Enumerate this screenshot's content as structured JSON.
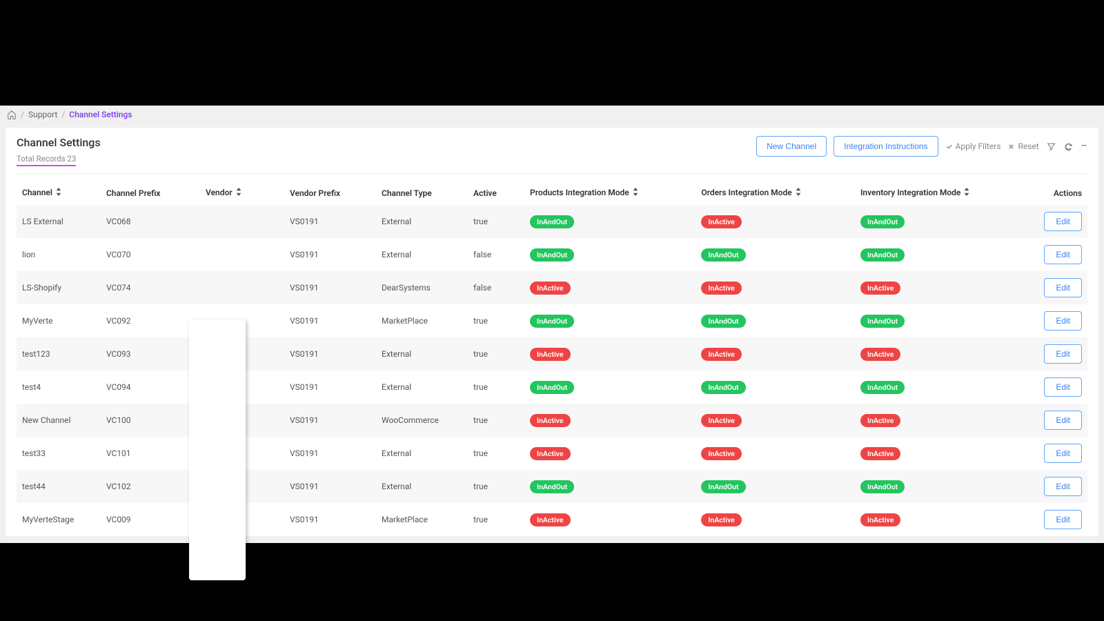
{
  "breadcrumb": {
    "support": "Support",
    "current": "Channel Settings"
  },
  "page": {
    "title": "Channel Settings",
    "subtitle": "Total Records 23"
  },
  "buttons": {
    "new_channel": "New Channel",
    "integration_instructions": "Integration Instructions",
    "apply_filters": "Apply Filters",
    "reset": "Reset",
    "edit": "Edit"
  },
  "columns": {
    "channel": "Channel",
    "channel_prefix": "Channel Prefix",
    "vendor": "Vendor",
    "vendor_prefix": "Vendor Prefix",
    "channel_type": "Channel Type",
    "active": "Active",
    "products_mode": "Products Integration Mode",
    "orders_mode": "Orders Integration Mode",
    "inventory_mode": "Inventory Integration Mode",
    "actions": "Actions"
  },
  "badge_labels": {
    "InAndOut": "InAndOut",
    "InActive": "InActive"
  },
  "rows": [
    {
      "channel": "LS External",
      "prefix": "VC068",
      "vendor": "",
      "vprefix": "VS0191",
      "ctype": "External",
      "active": "true",
      "products": "InAndOut",
      "orders": "InActive",
      "inventory": "InAndOut"
    },
    {
      "channel": "lion",
      "prefix": "VC070",
      "vendor": "",
      "vprefix": "VS0191",
      "ctype": "External",
      "active": "false",
      "products": "InAndOut",
      "orders": "InAndOut",
      "inventory": "InAndOut"
    },
    {
      "channel": "LS-Shopify",
      "prefix": "VC074",
      "vendor": "",
      "vprefix": "VS0191",
      "ctype": "DearSystems",
      "active": "false",
      "products": "InActive",
      "orders": "InActive",
      "inventory": "InActive"
    },
    {
      "channel": "MyVerte",
      "prefix": "VC092",
      "vendor": "",
      "vprefix": "VS0191",
      "ctype": "MarketPlace",
      "active": "true",
      "products": "InAndOut",
      "orders": "InAndOut",
      "inventory": "InAndOut"
    },
    {
      "channel": "test123",
      "prefix": "VC093",
      "vendor": "",
      "vprefix": "VS0191",
      "ctype": "External",
      "active": "true",
      "products": "InActive",
      "orders": "InActive",
      "inventory": "InActive"
    },
    {
      "channel": "test4",
      "prefix": "VC094",
      "vendor": "",
      "vprefix": "VS0191",
      "ctype": "External",
      "active": "true",
      "products": "InAndOut",
      "orders": "InAndOut",
      "inventory": "InAndOut"
    },
    {
      "channel": "New Channel",
      "prefix": "VC100",
      "vendor": "",
      "vprefix": "VS0191",
      "ctype": "WooCommerce",
      "active": "true",
      "products": "InActive",
      "orders": "InActive",
      "inventory": "InActive"
    },
    {
      "channel": "test33",
      "prefix": "VC101",
      "vendor": "",
      "vprefix": "VS0191",
      "ctype": "External",
      "active": "true",
      "products": "InActive",
      "orders": "InActive",
      "inventory": "InActive"
    },
    {
      "channel": "test44",
      "prefix": "VC102",
      "vendor": "",
      "vprefix": "VS0191",
      "ctype": "External",
      "active": "true",
      "products": "InAndOut",
      "orders": "InAndOut",
      "inventory": "InAndOut"
    },
    {
      "channel": "MyVerteStage",
      "prefix": "VC009",
      "vendor": "",
      "vprefix": "VS0191",
      "ctype": "MarketPlace",
      "active": "true",
      "products": "InActive",
      "orders": "InActive",
      "inventory": "InActive"
    }
  ]
}
